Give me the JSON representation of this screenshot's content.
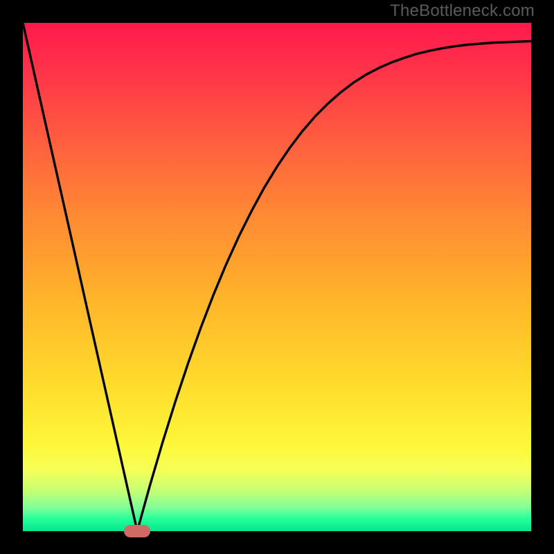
{
  "watermark": "TheBottleneck.com",
  "colors": {
    "frame": "#000000",
    "gradient_stops": [
      "#ff1a4b",
      "#ff2f4a",
      "#ff5a40",
      "#ff8a33",
      "#ffb62a",
      "#ffde2d",
      "#fdf73a",
      "#f6ff58",
      "#c6ff74",
      "#7dff9a",
      "#28ff9b",
      "#00e78b"
    ],
    "curve": "#000000",
    "marker": "#cf6a65"
  },
  "chart_data": {
    "type": "line",
    "title": "",
    "xlabel": "",
    "ylabel": "",
    "xlim": [
      0,
      100
    ],
    "ylim": [
      0,
      100
    ],
    "series": [
      {
        "name": "bottleneck-curve",
        "x": [
          0,
          2.5,
          5,
          7.5,
          10,
          12.5,
          15,
          17.5,
          20,
          22.5,
          25,
          27.5,
          30,
          32.5,
          35,
          37.5,
          40,
          42.5,
          45,
          47.5,
          50,
          52.5,
          55,
          57.5,
          60,
          62.5,
          65,
          67.5,
          70,
          72.5,
          75,
          77.5,
          80,
          82.5,
          85,
          87.5,
          90,
          92.5,
          95,
          97.5,
          100
        ],
        "values": [
          100,
          88.9,
          77.8,
          66.7,
          55.6,
          44.4,
          33.3,
          22.2,
          11.1,
          0,
          9.0,
          17.5,
          25.5,
          33.0,
          40.0,
          46.5,
          52.5,
          58.0,
          63.0,
          67.6,
          71.7,
          75.4,
          78.7,
          81.6,
          84.1,
          86.3,
          88.2,
          89.8,
          91.1,
          92.2,
          93.1,
          93.9,
          94.5,
          95.0,
          95.4,
          95.7,
          95.9,
          96.1,
          96.2,
          96.3,
          96.4
        ]
      }
    ],
    "marker": {
      "x": 22.5,
      "y": 0,
      "shape": "pill"
    },
    "annotations": []
  }
}
